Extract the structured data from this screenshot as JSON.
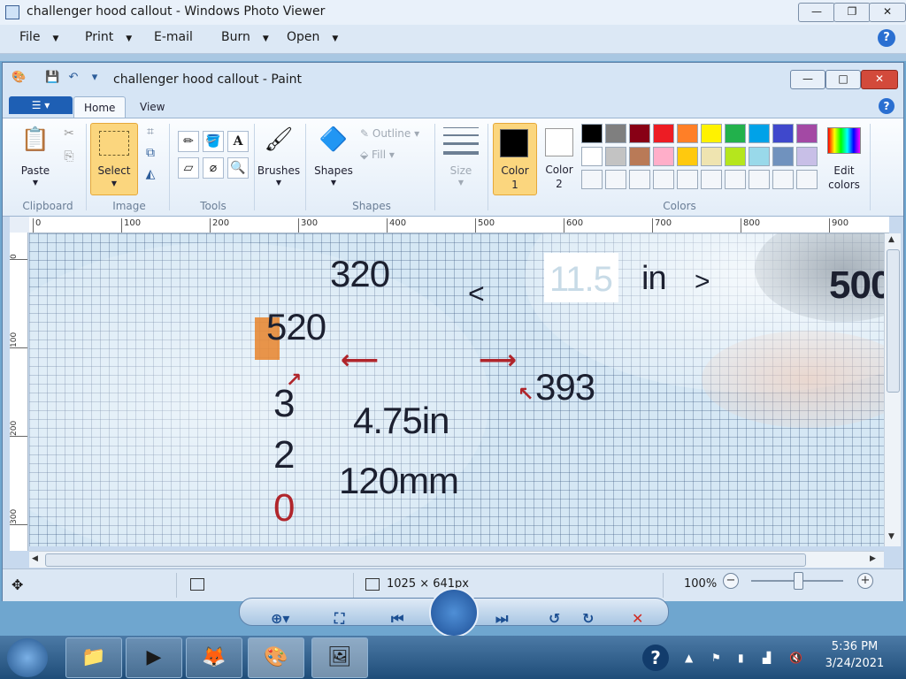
{
  "photo_viewer": {
    "title": "challenger hood callout - Windows Photo Viewer",
    "menu": [
      "File",
      "Print",
      "E-mail",
      "Burn",
      "Open"
    ],
    "help": "?"
  },
  "paint": {
    "title": "challenger hood callout - Paint",
    "tabs": [
      "Home",
      "View"
    ],
    "ribbon": {
      "clipboard": {
        "group": "Clipboard",
        "paste": "Paste"
      },
      "image": {
        "group": "Image",
        "select": "Select"
      },
      "tools": {
        "group": "Tools"
      },
      "brushes": "Brushes",
      "shapes": {
        "group": "Shapes",
        "shapes": "Shapes",
        "outline": "Outline",
        "fill": "Fill"
      },
      "size": "Size",
      "colors": {
        "group": "Colors",
        "color1": [
          "Color",
          "1"
        ],
        "color2": [
          "Color",
          "2"
        ],
        "edit": [
          "Edit",
          "colors"
        ],
        "color1_value": "#000000",
        "color2_value": "#ffffff",
        "palette_row1": [
          "#000000",
          "#7f7f7f",
          "#880015",
          "#ed1c24",
          "#ff7f27",
          "#fff200",
          "#22b14c",
          "#00a2e8",
          "#3f48cc",
          "#a349a4"
        ],
        "palette_row2": [
          "#ffffff",
          "#c3c3c3",
          "#b97a57",
          "#ffaec9",
          "#ffc90e",
          "#efe4b0",
          "#b5e61d",
          "#99d9ea",
          "#7092be",
          "#c8bfe7"
        ]
      }
    },
    "ruler_h": [
      "0",
      "100",
      "200",
      "300",
      "400",
      "500",
      "600",
      "700",
      "800",
      "900"
    ],
    "ruler_v": [
      "0",
      "100",
      "200",
      "300"
    ],
    "canvas_text": {
      "n320": "320",
      "arrow_left": "<",
      "box": "11.5",
      "unit": "in",
      "arrow_right": ">",
      "n500": "500",
      "n520": "520",
      "n393": "393",
      "n3": "3",
      "dim_in": "4.75in",
      "n2": "2",
      "dim_mm": "120mm",
      "n0": "0"
    },
    "status": {
      "dimensions": "1025 × 641px",
      "zoom": "100%"
    }
  },
  "taskbar": {
    "time": "5:36 PM",
    "date": "3/24/2021"
  }
}
